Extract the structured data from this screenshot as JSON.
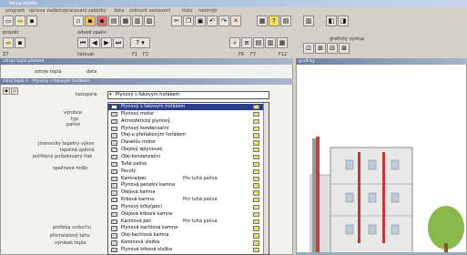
{
  "window": {
    "title": "tecsa-studio"
  },
  "menu": [
    "program",
    "úprava zadání",
    "zpracování zakázky",
    "data",
    "zobrazit sestavení",
    "tisky",
    "nástroje"
  ],
  "toolbar": {
    "group1_label": "projekt",
    "group2_label": "odvod spalin",
    "group3_label": "listovat",
    "f1": "F1",
    "f2": "F2",
    "f6": "F6",
    "f7": "F7",
    "f12": "F12",
    "z7": "Z7",
    "group4_label": "grafický výstup"
  },
  "left": {
    "header": "zdroje tepla přehled",
    "tab1": "zdroje tepla",
    "tab2": "data",
    "sub_header": "zdroj tepla 1 - Plynový s fakovým hořákem",
    "kategorie_label": "kategorie",
    "kategorie_value": "Plynový s fakovým hořákem",
    "labels": [
      "výrobce",
      "typ",
      "palivo",
      "jmenovitý tepelný výkon",
      "tepelná zpětná",
      "potřebný požadovaný tlak",
      "spalinové hrdlo",
      "potřeba vzduchu",
      "přeinstalový tahu",
      "výrobek tepla"
    ]
  },
  "dropdown": [
    {
      "label": "Plynový s fakovým hořákem",
      "selected": true,
      "extra": ""
    },
    {
      "label": "Plynový motor",
      "extra": ""
    },
    {
      "label": "Atmosférický plynový",
      "extra": ""
    },
    {
      "label": "Plynový kondenzační",
      "extra": ""
    },
    {
      "label": "Olej-u přetlakovým hořákem",
      "extra": ""
    },
    {
      "label": "Dieselův motor",
      "extra": ""
    },
    {
      "label": "Olejový zplynovač",
      "extra": ""
    },
    {
      "label": "Olej-kondenzační",
      "extra": ""
    },
    {
      "label": "Tuhé palivo",
      "extra": ""
    },
    {
      "label": "Pecolý",
      "extra": ""
    },
    {
      "label": "Kamna/pec",
      "extra": "Pro tuhá paliva"
    },
    {
      "label": "Plynová pečešní kamna",
      "extra": ""
    },
    {
      "label": "Olejová kamna",
      "extra": ""
    },
    {
      "label": "Krbová kamna",
      "extra": "Pro tuhá paliva"
    },
    {
      "label": "Plynový krby(pec)",
      "extra": ""
    },
    {
      "label": "Olejová krbová kamna",
      "extra": ""
    },
    {
      "label": "Kachlová pec",
      "extra": "Pro tuhá paliva"
    },
    {
      "label": "Plynová kachlová kamna",
      "extra": ""
    },
    {
      "label": "Olej-kachlová kamna",
      "extra": ""
    },
    {
      "label": "Kominová vložka",
      "extra": ""
    },
    {
      "label": "Plynová krbová vložka",
      "extra": ""
    }
  ],
  "graphic": {
    "header": "grafický"
  }
}
